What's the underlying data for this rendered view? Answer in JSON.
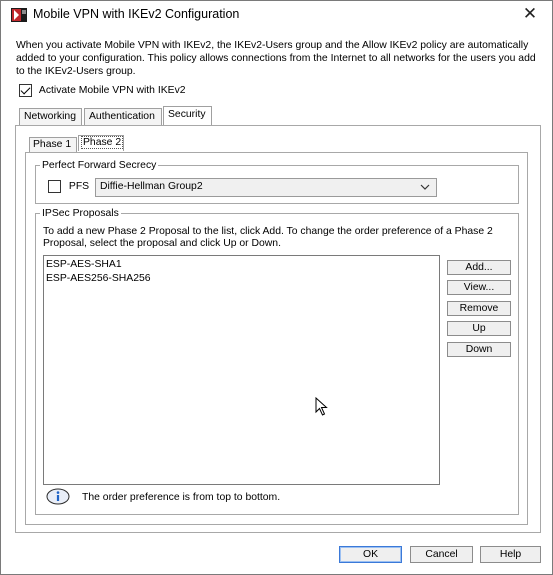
{
  "window": {
    "title": "Mobile VPN with IKEv2 Configuration",
    "close_glyph": "✕"
  },
  "description": "When you activate Mobile VPN with IKEv2, the IKEv2-Users group and the Allow IKEv2 policy are automatically added to your configuration. This policy allows connections from the Internet to all networks for the users you add to the IKEv2-Users group.",
  "activate": {
    "label": "Activate Mobile VPN with IKEv2",
    "checked": true
  },
  "tabs": [
    {
      "label": "Networking",
      "active": false
    },
    {
      "label": "Authentication",
      "active": false
    },
    {
      "label": "Security",
      "active": true
    }
  ],
  "subtabs": [
    {
      "label": "Phase 1",
      "active": false
    },
    {
      "label": "Phase 2",
      "active": true
    }
  ],
  "pfs_group": {
    "legend": "Perfect Forward Secrecy",
    "pfs_label": "PFS",
    "pfs_checked": false,
    "dh_selected": "Diffie-Hellman Group2"
  },
  "ipsec_group": {
    "legend": "IPSec Proposals",
    "instructions": "To add a new Phase 2 Proposal to the list, click Add. To change the order preference of a Phase 2 Proposal, select the proposal and click Up or Down.",
    "proposals": [
      "ESP-AES-SHA1",
      "ESP-AES256-SHA256"
    ],
    "buttons": {
      "add": "Add...",
      "view": "View...",
      "remove": "Remove",
      "up": "Up",
      "down": "Down"
    },
    "info_text": "The order preference is from top to bottom."
  },
  "footer": {
    "ok": "OK",
    "cancel": "Cancel",
    "help": "Help"
  },
  "icons": {
    "app": "watchguard-icon",
    "info": "info-icon",
    "dropdown": "chevron-down-icon",
    "cursor": "mouse-pointer-icon"
  },
  "colors": {
    "default_button_border": "#3b79d8",
    "app_icon_red": "#c0282d",
    "info_icon_blue": "#1f63c6"
  }
}
